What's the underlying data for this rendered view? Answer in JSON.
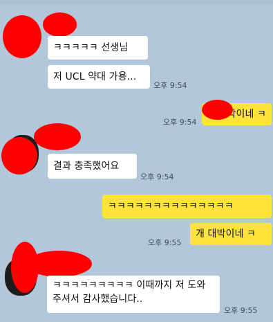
{
  "chat": {
    "messages": [
      {
        "text": "ㅋㅋㅋㅋㅋ 선생님",
        "time": ""
      },
      {
        "text": "저 UCL 약대 가용...",
        "time": "오후 9:54"
      },
      {
        "text": "박이네 ㅋ",
        "time": "오후 9:54"
      },
      {
        "text": "결과 충족했어요",
        "time": "오후 9:54"
      },
      {
        "text": "ㅋㅋㅋㅋㅋㅋㅋㅋㅋㅋㅋㅋㅋㅋ",
        "time": ""
      },
      {
        "text": "개 대박이네 ㅋ",
        "time": "오후 9:55"
      },
      {
        "text": "ㅋㅋㅋㅋㅋㅋㅋㅋㅋ 이때까지 저 도와주셔서 감사했습니다..",
        "time": "오후 9:55"
      }
    ]
  },
  "colors": {
    "background": "#b2c7d9",
    "incoming_bubble": "#ffffff",
    "outgoing_bubble": "#fee33a",
    "redaction": "#ff0000"
  }
}
